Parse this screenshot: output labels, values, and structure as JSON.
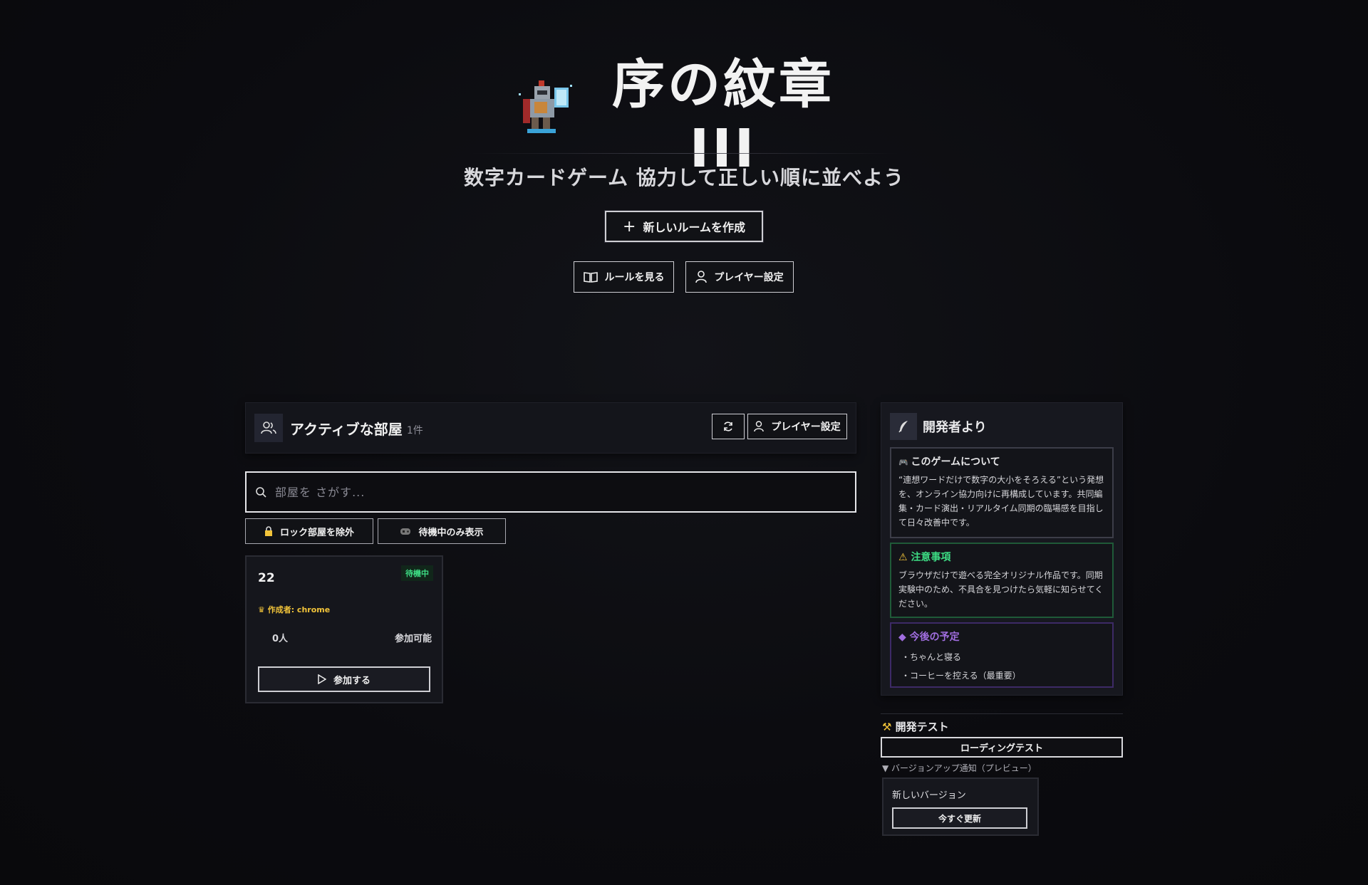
{
  "hero": {
    "title": "序の紋章III",
    "subtitle": "数字カードゲーム 協力して正しい順に並べよう",
    "create_button": "新しいルームを作成",
    "rules_button": "ルールを見る",
    "player_settings_button": "プレイヤー設定"
  },
  "rooms_panel": {
    "title": "アクティブな部屋",
    "count": "1件",
    "player_settings_button": "プレイヤー設定",
    "search_placeholder": "部屋を さがす...",
    "filter_locked": "ロック部屋を除外",
    "filter_waiting": "待機中のみ表示",
    "rooms": [
      {
        "name": "22",
        "status": "待機中",
        "owner": "作成者: chrome",
        "players": "0人",
        "join_state": "参加可能",
        "join_button": "参加する"
      }
    ]
  },
  "dev_panel": {
    "title": "開発者より",
    "about_title": "このゲームについて",
    "about_body": "“連想ワードだけで数字の大小をそろえる”という発想を、オンライン協力向けに再構成しています。共同編集・カード演出・リアルタイム同期の臨場感を目指して日々改善中です。",
    "warn_title": "注意事項",
    "warn_body": "ブラウザだけで遊べる完全オリジナル作品です。同期実験中のため、不具合を見つけたら気軽に知らせてください。",
    "plan_title": "今後の予定",
    "plan_items": [
      "・ちゃんと寝る",
      "・コーヒーを控える（最重要）"
    ]
  },
  "dev_test": {
    "title": "開発テスト",
    "loading_button": "ローディングテスト",
    "version_summary": "▼ バージョンアップ通知（プレビュー）",
    "version_text": "新しいバージョン",
    "update_button": "今すぐ更新"
  },
  "colors": {
    "background": "#0b0b0f",
    "waiting_green": "#3ddc84",
    "owner_gold": "#f2c43a",
    "plan_purple": "#a16ee0"
  }
}
